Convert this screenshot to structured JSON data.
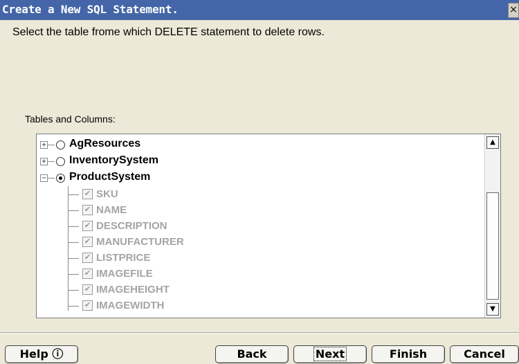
{
  "window": {
    "title": "Create a New SQL Statement.",
    "close_label": "×"
  },
  "instruction": "Select the table frome which DELETE statement to delete rows.",
  "section_label": "Tables and Columns:",
  "tree": {
    "tables": [
      {
        "name": "AgResources",
        "expanded": false,
        "selected": false,
        "expander": "+"
      },
      {
        "name": "InventorySystem",
        "expanded": false,
        "selected": false,
        "expander": "+"
      },
      {
        "name": "ProductSystem",
        "expanded": true,
        "selected": true,
        "expander": "−"
      }
    ],
    "columns": [
      {
        "name": "SKU",
        "checked": true
      },
      {
        "name": "NAME",
        "checked": true
      },
      {
        "name": "DESCRIPTION",
        "checked": true
      },
      {
        "name": "MANUFACTURER",
        "checked": true
      },
      {
        "name": "LISTPRICE",
        "checked": true
      },
      {
        "name": "IMAGEFILE",
        "checked": true
      },
      {
        "name": "IMAGEHEIGHT",
        "checked": true
      },
      {
        "name": "IMAGEWIDTH",
        "checked": true
      }
    ],
    "check_glyph": "✔"
  },
  "scrollbar": {
    "up_arrow": "▲",
    "down_arrow": "▼"
  },
  "buttons": {
    "help": "Help ⓘ",
    "back": "Back",
    "next": "Next",
    "finish": "Finish",
    "cancel": "Cancel"
  }
}
